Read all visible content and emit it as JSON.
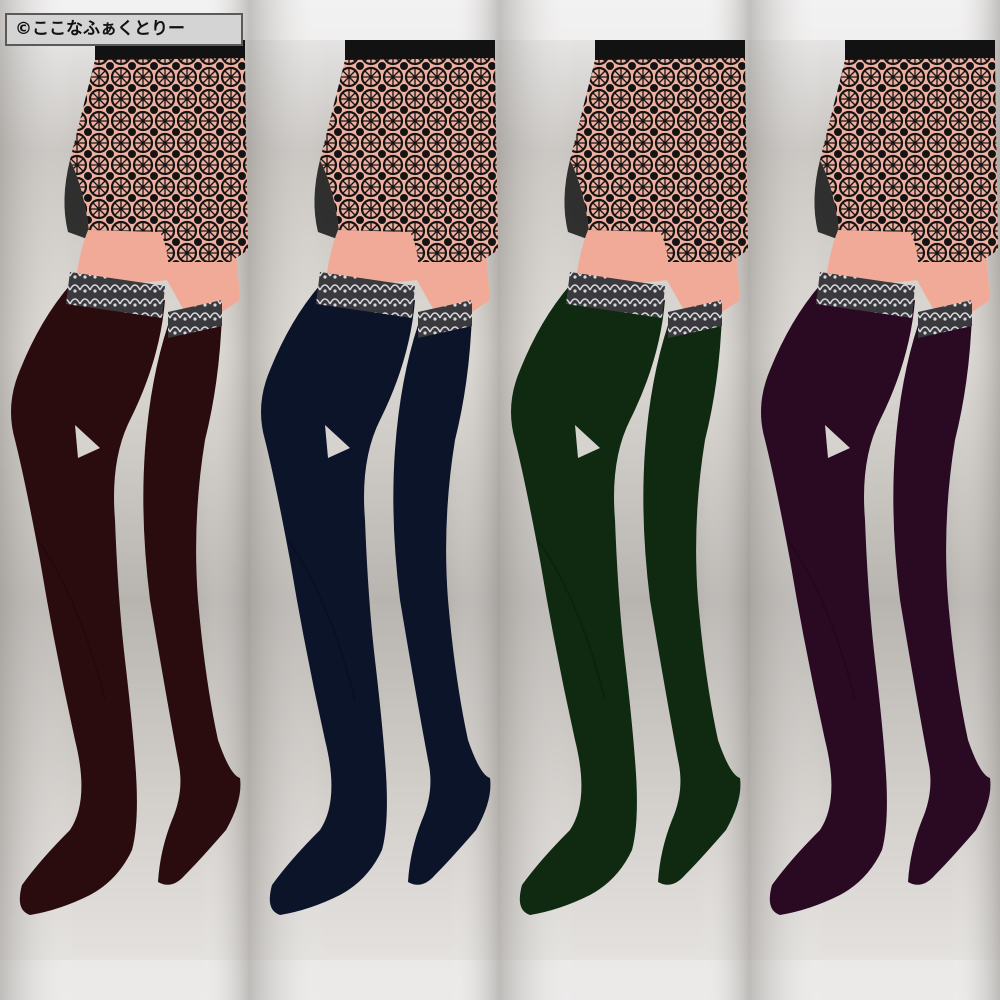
{
  "copyright": "©ここなふぁくとりー",
  "colors": {
    "background_blur": "#c9c5c1",
    "skin": "#f2aa98",
    "lace_skirt": "#141414",
    "lace_trim": "#c8c8cc"
  },
  "variants": [
    {
      "name": "burgundy",
      "color": "#2a0c0e"
    },
    {
      "name": "navy",
      "color": "#0b1428"
    },
    {
      "name": "green",
      "color": "#0f2a10"
    },
    {
      "name": "purple",
      "color": "#2a0a22"
    }
  ]
}
